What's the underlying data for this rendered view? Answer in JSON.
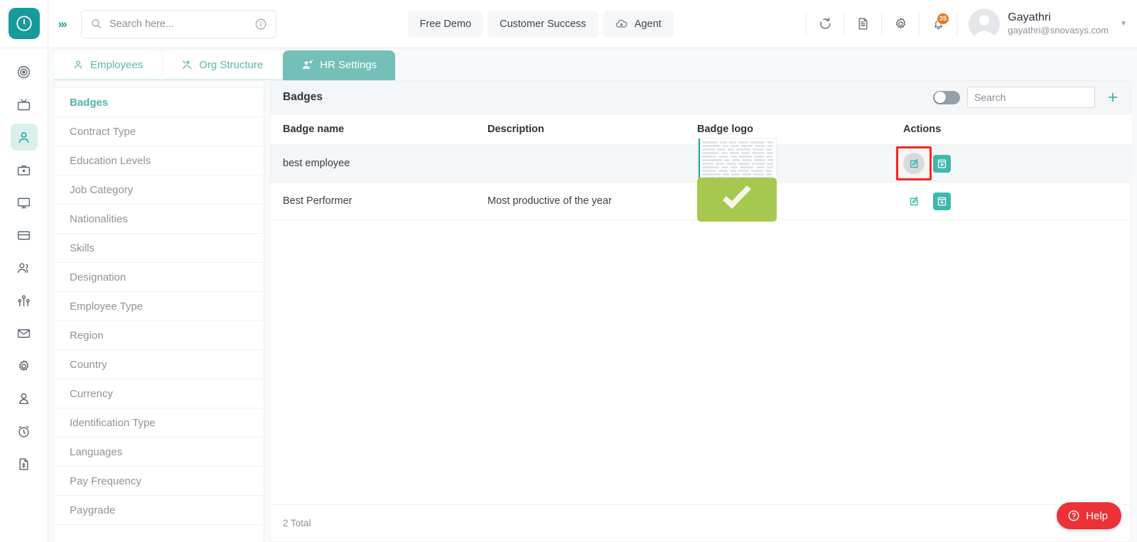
{
  "colors": {
    "brand_teal": "#17a398",
    "tab_active": "#74bfb8",
    "accent_orange": "#f0731a",
    "help_red": "#ec3237",
    "badge_green": "#a6c84e",
    "highlight_red": "#ff2222"
  },
  "rail": {
    "logo_icon": "clock-logo-icon",
    "items": [
      {
        "icon": "target-icon",
        "name": "rail-item-target",
        "active": false
      },
      {
        "icon": "tv-icon",
        "name": "rail-item-tv",
        "active": false
      },
      {
        "icon": "person-icon",
        "name": "rail-item-employees",
        "active": true
      },
      {
        "icon": "briefcase-icon",
        "name": "rail-item-jobs",
        "active": false
      },
      {
        "icon": "monitor-icon",
        "name": "rail-item-assets",
        "active": false
      },
      {
        "icon": "credit-card-icon",
        "name": "rail-item-payroll",
        "active": false
      },
      {
        "icon": "people-icon",
        "name": "rail-item-teams",
        "active": false
      },
      {
        "icon": "group-icon",
        "name": "rail-item-org",
        "active": false
      },
      {
        "icon": "envelope-icon",
        "name": "rail-item-mail",
        "active": false
      },
      {
        "icon": "gear-icon",
        "name": "rail-item-settings",
        "active": false
      },
      {
        "icon": "user-icon",
        "name": "rail-item-profile",
        "active": false
      },
      {
        "icon": "alarm-clock-icon",
        "name": "rail-item-time",
        "active": false
      },
      {
        "icon": "invoice-icon",
        "name": "rail-item-invoice",
        "active": false
      }
    ]
  },
  "header": {
    "expand_icon": "chevron-right-triple-icon",
    "search": {
      "placeholder": "Search here...",
      "value": "",
      "icon": "search-icon",
      "info_icon": "info-circle-icon"
    },
    "buttons": [
      {
        "label": "Free Demo",
        "icon": null
      },
      {
        "label": "Customer Success",
        "icon": null
      },
      {
        "label": "Agent",
        "icon": "cloud-download-icon"
      }
    ],
    "icons": [
      {
        "name": "refresh-icon"
      },
      {
        "name": "document-icon"
      },
      {
        "name": "gear-icon"
      }
    ],
    "notifications": {
      "icon": "bell-icon",
      "count": "35"
    },
    "profile": {
      "name": "Gayathri",
      "email": "gayathri@snovasys.com",
      "avatar_icon": "avatar-icon",
      "caret_icon": "chevron-down-icon"
    }
  },
  "tabs": [
    {
      "label": "Employees",
      "icon": "person-icon",
      "active": false
    },
    {
      "label": "Org Structure",
      "icon": "tools-icon",
      "active": false
    },
    {
      "label": "HR Settings",
      "icon": "user-gear-icon",
      "active": true
    }
  ],
  "sidebar": {
    "items": [
      {
        "label": "Badges",
        "active": true
      },
      {
        "label": "Contract Type",
        "active": false
      },
      {
        "label": "Education Levels",
        "active": false
      },
      {
        "label": "Job Category",
        "active": false
      },
      {
        "label": "Nationalities",
        "active": false
      },
      {
        "label": "Skills",
        "active": false
      },
      {
        "label": "Designation",
        "active": false
      },
      {
        "label": "Employee Type",
        "active": false
      },
      {
        "label": "Region",
        "active": false
      },
      {
        "label": "Country",
        "active": false
      },
      {
        "label": "Currency",
        "active": false
      },
      {
        "label": "Identification Type",
        "active": false
      },
      {
        "label": "Languages",
        "active": false
      },
      {
        "label": "Pay Frequency",
        "active": false
      },
      {
        "label": "Paygrade",
        "active": false
      }
    ]
  },
  "panel": {
    "title": "Badges",
    "toggle": {
      "name": "archive-toggle",
      "state": "off"
    },
    "search": {
      "placeholder": "Search",
      "value": ""
    },
    "add_button": {
      "label": "+",
      "name": "add-badge-button"
    },
    "columns": [
      "Badge name",
      "Description",
      "Badge logo",
      "Actions"
    ],
    "rows": [
      {
        "badge_name": "best employee",
        "description": "",
        "logo_type": "spreadsheet-screenshot",
        "highlighted": true,
        "edit_icon": "edit-icon",
        "archive_icon": "archive-download-icon"
      },
      {
        "badge_name": "Best Performer",
        "description": "Most productive of the year",
        "logo_type": "green-checkmark",
        "highlighted": false,
        "edit_icon": "edit-icon",
        "archive_icon": "archive-download-icon"
      }
    ],
    "footer_total": "2 Total"
  },
  "help": {
    "label": "Help",
    "icon": "question-circle-icon"
  }
}
